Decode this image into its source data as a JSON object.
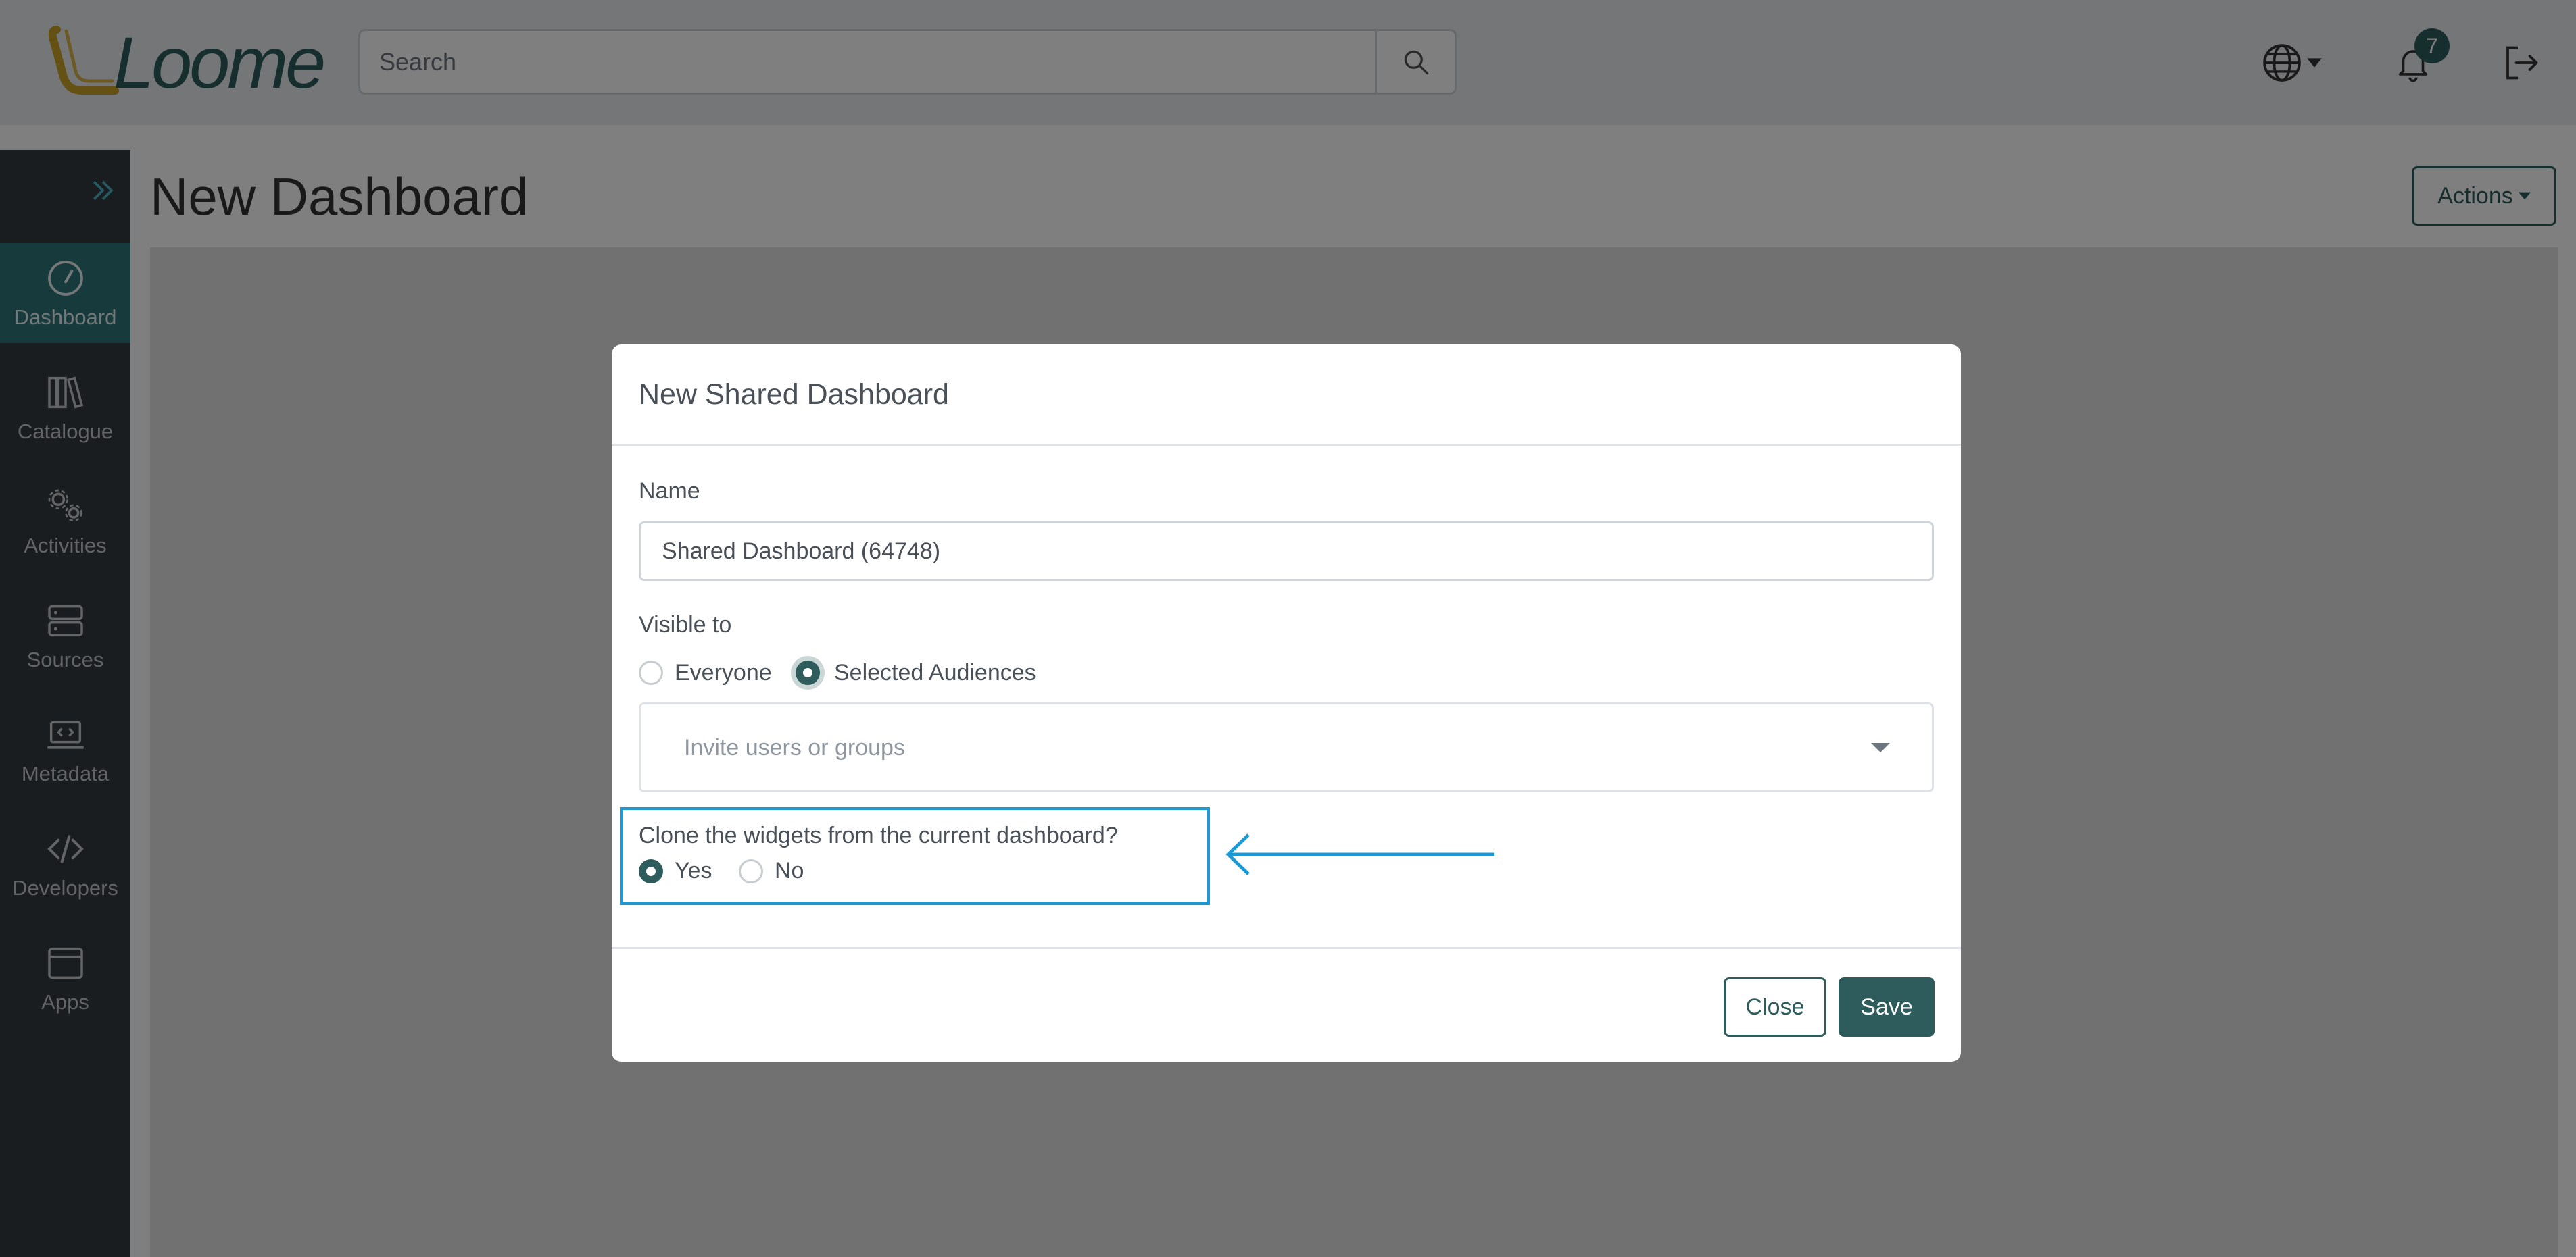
{
  "header": {
    "logo_text": "Loome",
    "search": {
      "placeholder": "Search",
      "value": ""
    },
    "notifications_count": "7",
    "icons": [
      "search-icon",
      "globe-icon",
      "bell-icon",
      "logout-icon"
    ]
  },
  "sidebar": {
    "toggle_icon": "double-chevron-right-icon",
    "items": [
      {
        "label": "Dashboard",
        "icon": "gauge-icon",
        "active": true
      },
      {
        "label": "Catalogue",
        "icon": "books-icon",
        "active": false
      },
      {
        "label": "Activities",
        "icon": "gears-icon",
        "active": false
      },
      {
        "label": "Sources",
        "icon": "server-icon",
        "active": false
      },
      {
        "label": "Metadata",
        "icon": "laptop-code-icon",
        "active": false
      },
      {
        "label": "Developers",
        "icon": "code-icon",
        "active": false
      },
      {
        "label": "Apps",
        "icon": "window-icon",
        "active": false
      }
    ]
  },
  "page": {
    "title": "New Dashboard",
    "actions_label": "Actions"
  },
  "modal": {
    "title": "New Shared Dashboard",
    "name_label": "Name",
    "name_value": "Shared Dashboard (64748)",
    "visible_label": "Visible to",
    "visible_options": [
      {
        "label": "Everyone",
        "checked": false
      },
      {
        "label": "Selected Audiences",
        "checked": true
      }
    ],
    "invite_placeholder": "Invite users or groups",
    "clone_label": "Clone the widgets from the current dashboard?",
    "clone_options": [
      {
        "label": "Yes",
        "checked": true
      },
      {
        "label": "No",
        "checked": false
      }
    ],
    "close_label": "Close",
    "save_label": "Save"
  },
  "colors": {
    "brand_teal": "#2e5c5c",
    "sidebar_bg": "#343a40",
    "sidebar_active": "#2f7479",
    "highlight_blue": "#1b9ad6",
    "logo_gold": "#c9a227"
  }
}
